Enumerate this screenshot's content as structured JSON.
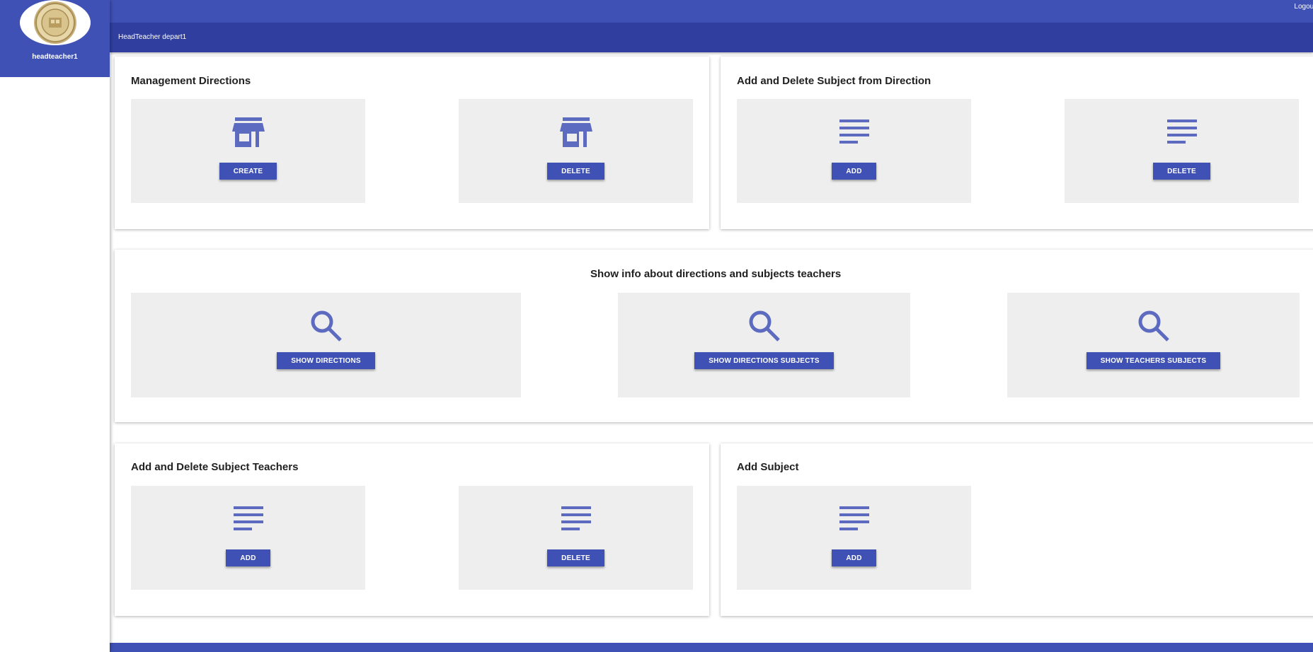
{
  "app": {
    "logout_label": "Logout",
    "header_title": "HeadTeacher depart1",
    "colors": {
      "primary": "#3f51b5",
      "primary_dark": "#303f9f",
      "icon": "#5c6bc0",
      "tile_bg": "#eeeeee"
    }
  },
  "sidebar": {
    "username": "headteacher1",
    "logo_icon": "school-seal-logo"
  },
  "cards": {
    "management_directions": {
      "title": "Management Directions",
      "tiles": [
        {
          "icon": "store-icon",
          "button": "CREATE"
        },
        {
          "icon": "store-icon",
          "button": "DELETE"
        }
      ]
    },
    "subject_direction": {
      "title": "Add and Delete Subject from Direction",
      "tiles": [
        {
          "icon": "notes-icon",
          "button": "ADD"
        },
        {
          "icon": "notes-icon",
          "button": "DELETE"
        }
      ]
    },
    "show_info": {
      "title": "Show info about directions and subjects teachers",
      "tiles": [
        {
          "icon": "search-icon",
          "button": "SHOW DIRECTIONS"
        },
        {
          "icon": "search-icon",
          "button": "SHOW DIRECTIONS SUBJECTS"
        },
        {
          "icon": "search-icon",
          "button": "SHOW TEACHERS SUBJECTS"
        }
      ]
    },
    "subject_teachers": {
      "title": "Add and Delete Subject Teachers",
      "tiles": [
        {
          "icon": "notes-icon",
          "button": "ADD"
        },
        {
          "icon": "notes-icon",
          "button": "DELETE"
        }
      ]
    },
    "add_subject": {
      "title": "Add Subject",
      "tiles": [
        {
          "icon": "notes-icon",
          "button": "ADD"
        }
      ]
    }
  }
}
